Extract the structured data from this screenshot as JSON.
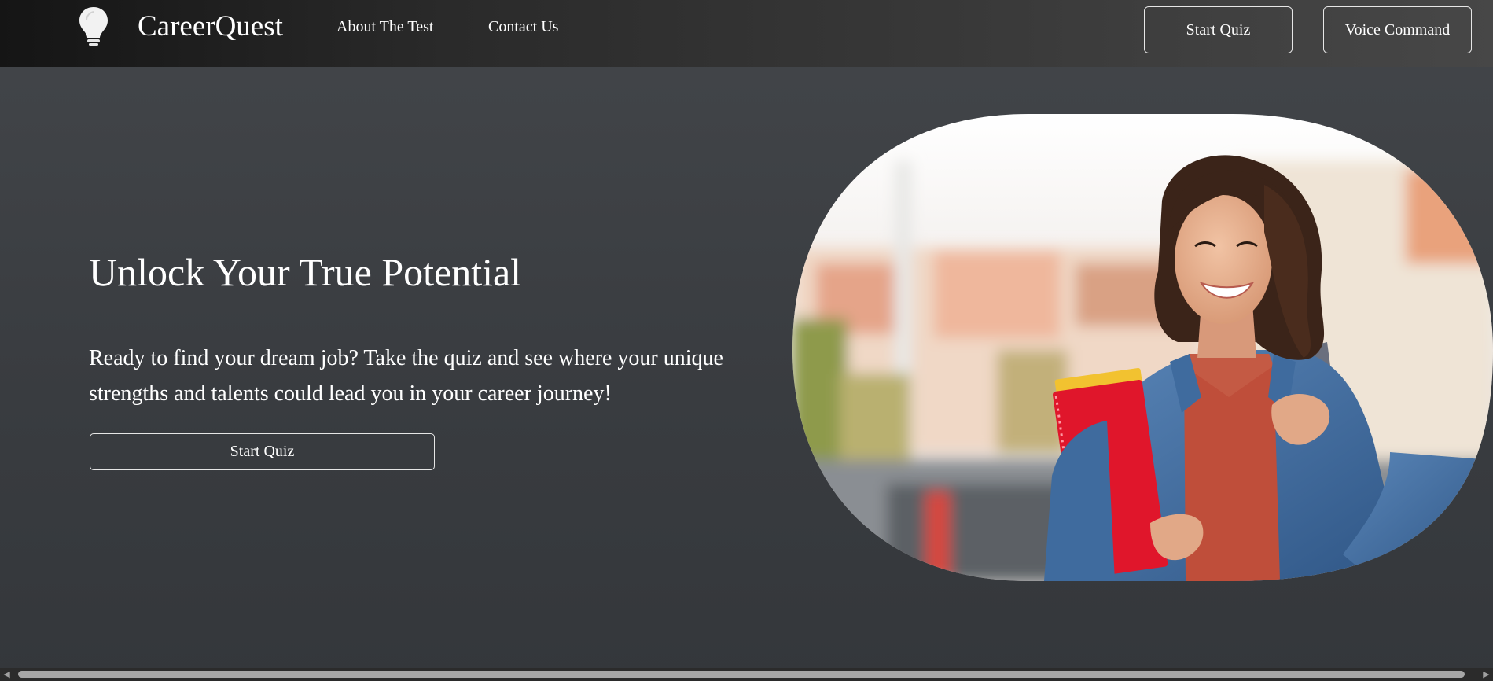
{
  "header": {
    "brand": "CareerQuest",
    "logo_icon": "lightbulb-icon",
    "nav": [
      {
        "label": "About The Test"
      },
      {
        "label": "Contact Us"
      }
    ],
    "buttons": {
      "start_quiz": "Start Quiz",
      "voice_command": "Voice Command"
    }
  },
  "hero": {
    "title": "Unlock Your True Potential",
    "description": "Ready to find your dream job? Take the quiz and see where your unique strengths and talents could lead you in your career journey!",
    "cta": "Start Quiz",
    "image_alt": "smiling student holding red notebook"
  },
  "scrollbar": {
    "left_icon": "triangle-left-icon",
    "right_icon": "triangle-right-icon"
  },
  "colors": {
    "header_dark": "#151515",
    "body_bg": "#3a3d41",
    "text": "#ffffff",
    "notebook_red": "#e0162b",
    "denim": "#3f6b9e"
  }
}
